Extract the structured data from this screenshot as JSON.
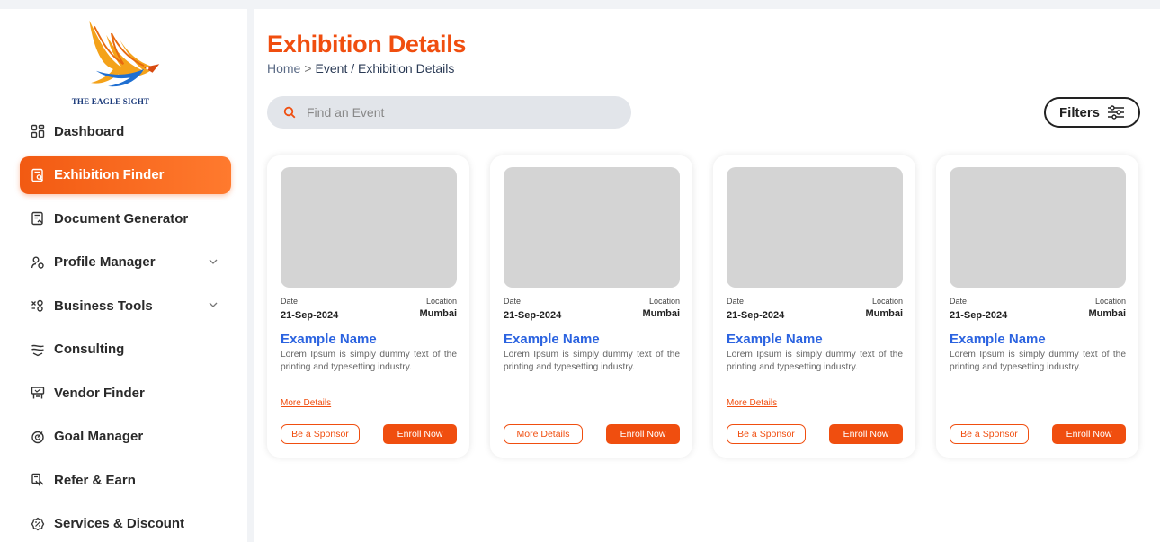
{
  "brand": {
    "name": "THE EAGLE SIGHT"
  },
  "colors": {
    "accent": "#f04e0f",
    "link_blue": "#2b63e0",
    "nav_active_bg": "#f25a12"
  },
  "sidebar": {
    "items": [
      {
        "label": "Dashboard",
        "icon": "dashboard-icon",
        "active": false,
        "expandable": false
      },
      {
        "label": "Exhibition Finder",
        "icon": "exhibition-finder-icon",
        "active": true,
        "expandable": false
      },
      {
        "label": "Document Generator",
        "icon": "document-generator-icon",
        "active": false,
        "expandable": false
      },
      {
        "label": "Profile Manager",
        "icon": "profile-manager-icon",
        "active": false,
        "expandable": true
      },
      {
        "label": "Business Tools",
        "icon": "business-tools-icon",
        "active": false,
        "expandable": true
      },
      {
        "label": "Consulting",
        "icon": "consulting-icon",
        "active": false,
        "expandable": false
      },
      {
        "label": "Vendor Finder",
        "icon": "vendor-finder-icon",
        "active": false,
        "expandable": false
      },
      {
        "label": "Goal Manager",
        "icon": "goal-manager-icon",
        "active": false,
        "expandable": false
      },
      {
        "label": "Refer & Earn",
        "icon": "refer-earn-icon",
        "active": false,
        "expandable": false
      },
      {
        "label": "Services & Discount",
        "icon": "services-discount-icon",
        "active": false,
        "expandable": false
      }
    ]
  },
  "header": {
    "title": "Exhibition Details",
    "breadcrumb": {
      "home": "Home",
      "separator": ">",
      "current": "Event / Exhibition Details"
    }
  },
  "search": {
    "placeholder": "Find an Event",
    "icon": "search-icon"
  },
  "filters": {
    "label": "Filters",
    "icon": "sliders-icon"
  },
  "cards": [
    {
      "date_label": "Date",
      "date": "21-Sep-2024",
      "location_label": "Location",
      "location": "Mumbai",
      "name": "Example Name",
      "description": "Lorem Ipsum is simply dummy text of the printing and typesetting industry.",
      "more_details": "More Details",
      "secondary_button": "Be a Sponsor",
      "primary_button": "Enroll Now"
    },
    {
      "date_label": "Date",
      "date": "21-Sep-2024",
      "location_label": "Location",
      "location": "Mumbai",
      "name": "Example Name",
      "description": "Lorem Ipsum is simply dummy text of the printing and typesetting industry.",
      "more_details": "",
      "secondary_button": "More Details",
      "primary_button": "Enroll Now"
    },
    {
      "date_label": "Date",
      "date": "21-Sep-2024",
      "location_label": "Location",
      "location": "Mumbai",
      "name": "Example Name",
      "description": "Lorem Ipsum is simply dummy text of the printing and typesetting industry.",
      "more_details": "More Details",
      "secondary_button": "Be a Sponsor",
      "primary_button": "Enroll Now"
    },
    {
      "date_label": "Date",
      "date": "21-Sep-2024",
      "location_label": "Location",
      "location": "Mumbai",
      "name": "Example Name",
      "description": "Lorem Ipsum is simply dummy text of the printing and typesetting industry.",
      "more_details": "",
      "secondary_button": "Be a Sponsor",
      "primary_button": "Enroll Now"
    }
  ]
}
